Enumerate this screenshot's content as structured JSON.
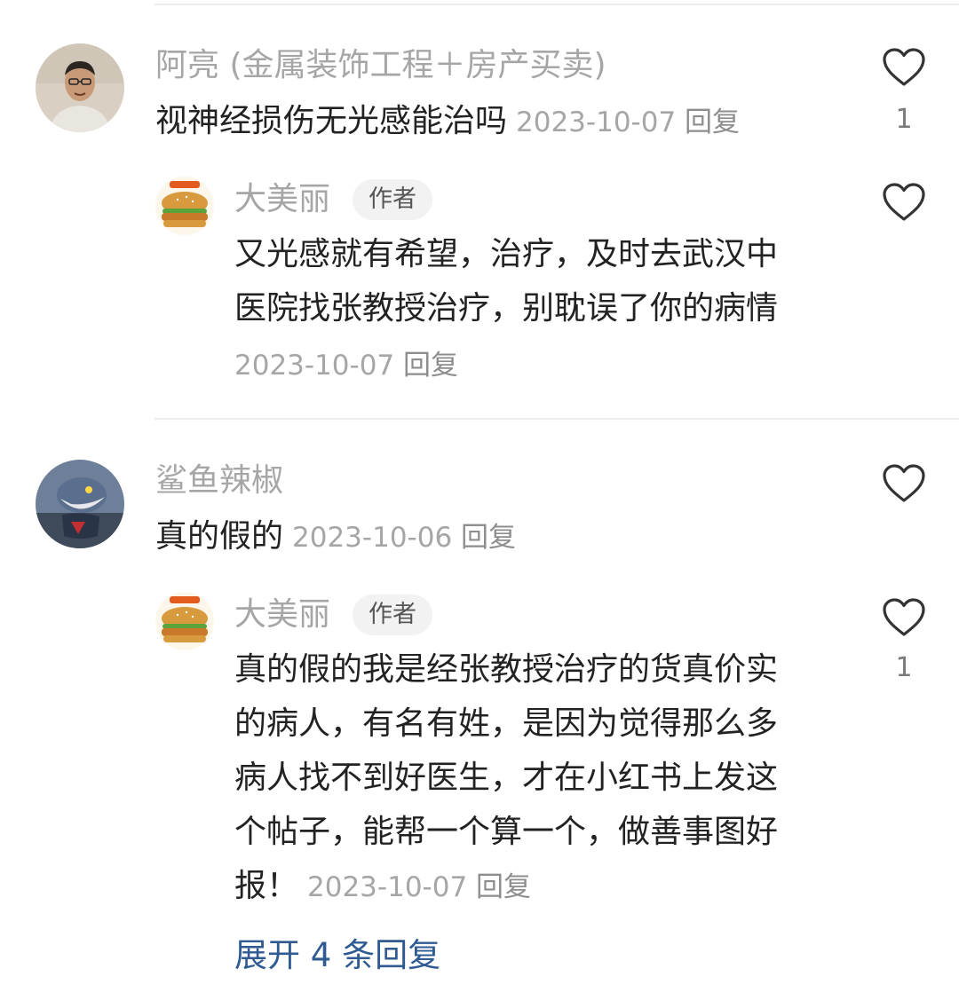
{
  "comments": [
    {
      "username": "阿亮 (金属装饰工程＋房产买卖)",
      "text": "视神经损伤无光感能治吗",
      "date": "2023-10-07",
      "reply_label": "回复",
      "like_count": "1",
      "reply": {
        "username": "大美丽",
        "badge": "作者",
        "lines": [
          "又光感就有希望，治疗，及时去武汉中",
          "医院找张教授治疗，别耽误了你的病情"
        ],
        "date": "2023-10-07",
        "reply_label": "回复"
      }
    },
    {
      "username": "鲨鱼辣椒",
      "text": "真的假的",
      "date": "2023-10-06",
      "reply_label": "回复",
      "reply": {
        "username": "大美丽",
        "badge": "作者",
        "lines": [
          "真的假的我是经张教授治疗的货真价实",
          "的病人，有名有姓，是因为觉得那么多",
          "病人找不到好医生，才在小红书上发这",
          "个帖子，能帮一个算一个，做善事图好",
          "报！"
        ],
        "date": "2023-10-07",
        "reply_label": "回复",
        "like_count": "1"
      },
      "expand_label": "展开 4 条回复"
    }
  ],
  "colors": {
    "username": "#a6a6a6",
    "text": "#222222",
    "meta": "#a6a6a6",
    "link": "#2f5b92",
    "badge_bg": "#f2f2f2"
  },
  "icons": {
    "like": "heart-outline-icon"
  }
}
